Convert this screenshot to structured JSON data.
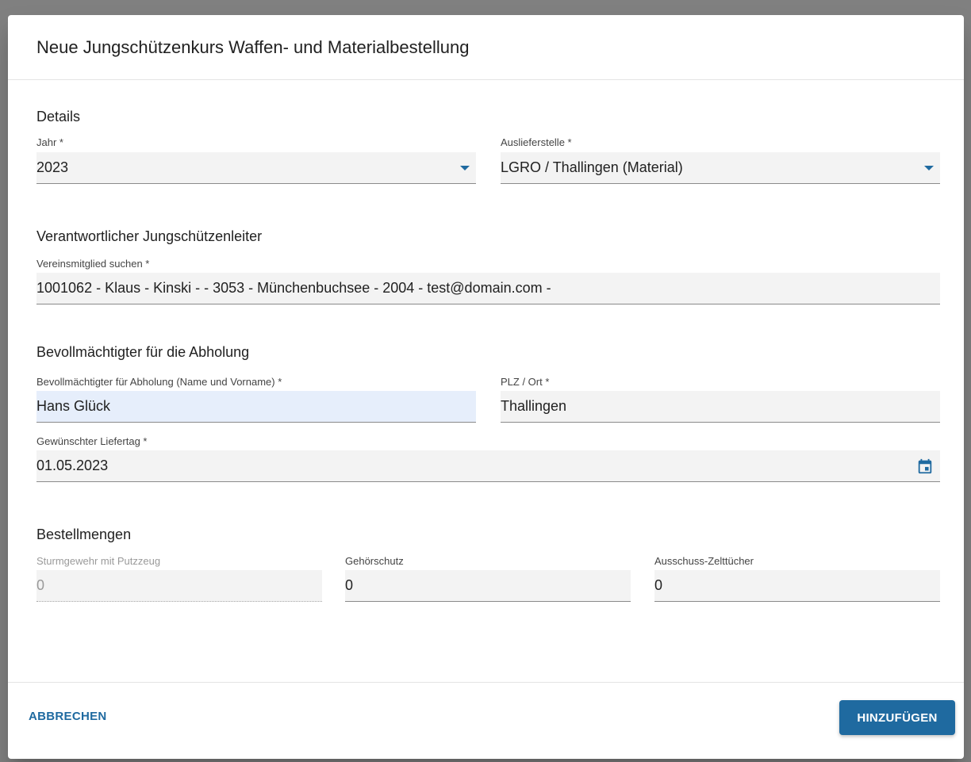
{
  "dialog": {
    "title": "Neue Jungschützenkurs Waffen- und Materialbestellung"
  },
  "details": {
    "heading": "Details",
    "jahr_label": "Jahr *",
    "jahr_value": "2023",
    "auslieferstelle_label": "Auslieferstelle *",
    "auslieferstelle_value": "LGRO / Thallingen (Material)"
  },
  "leiter": {
    "heading": "Verantwortlicher Jungschützenleiter",
    "search_label": "Vereinsmitglied suchen *",
    "search_value": "1001062 - Klaus - Kinski -  - 3053 - Münchenbuchsee - 2004 - test@domain.com -"
  },
  "abholung": {
    "heading": "Bevollmächtigter für die Abholung",
    "name_label": "Bevollmächtigter für Abholung (Name und Vorname) *",
    "name_value": "Hans Glück",
    "plz_label": "PLZ / Ort *",
    "plz_value": "Thallingen",
    "liefertag_label": "Gewünschter Liefertag *",
    "liefertag_value": "01.05.2023"
  },
  "bestellmengen": {
    "heading": "Bestellmengen",
    "sturmgewehr_label": "Sturmgewehr mit Putzzeug",
    "sturmgewehr_value": "0",
    "gehoerschutz_label": "Gehörschutz",
    "gehoerschutz_value": "0",
    "zelttuecher_label": "Ausschuss-Zelttücher",
    "zelttuecher_value": "0"
  },
  "actions": {
    "cancel_label": "ABBRECHEN",
    "submit_label": "HINZUFÜGEN"
  },
  "icons": {
    "dropdown": "chevron-down-icon",
    "calendar": "calendar-icon"
  },
  "colors": {
    "accent": "#1f6aa0",
    "active_field": "#e6eefb"
  }
}
